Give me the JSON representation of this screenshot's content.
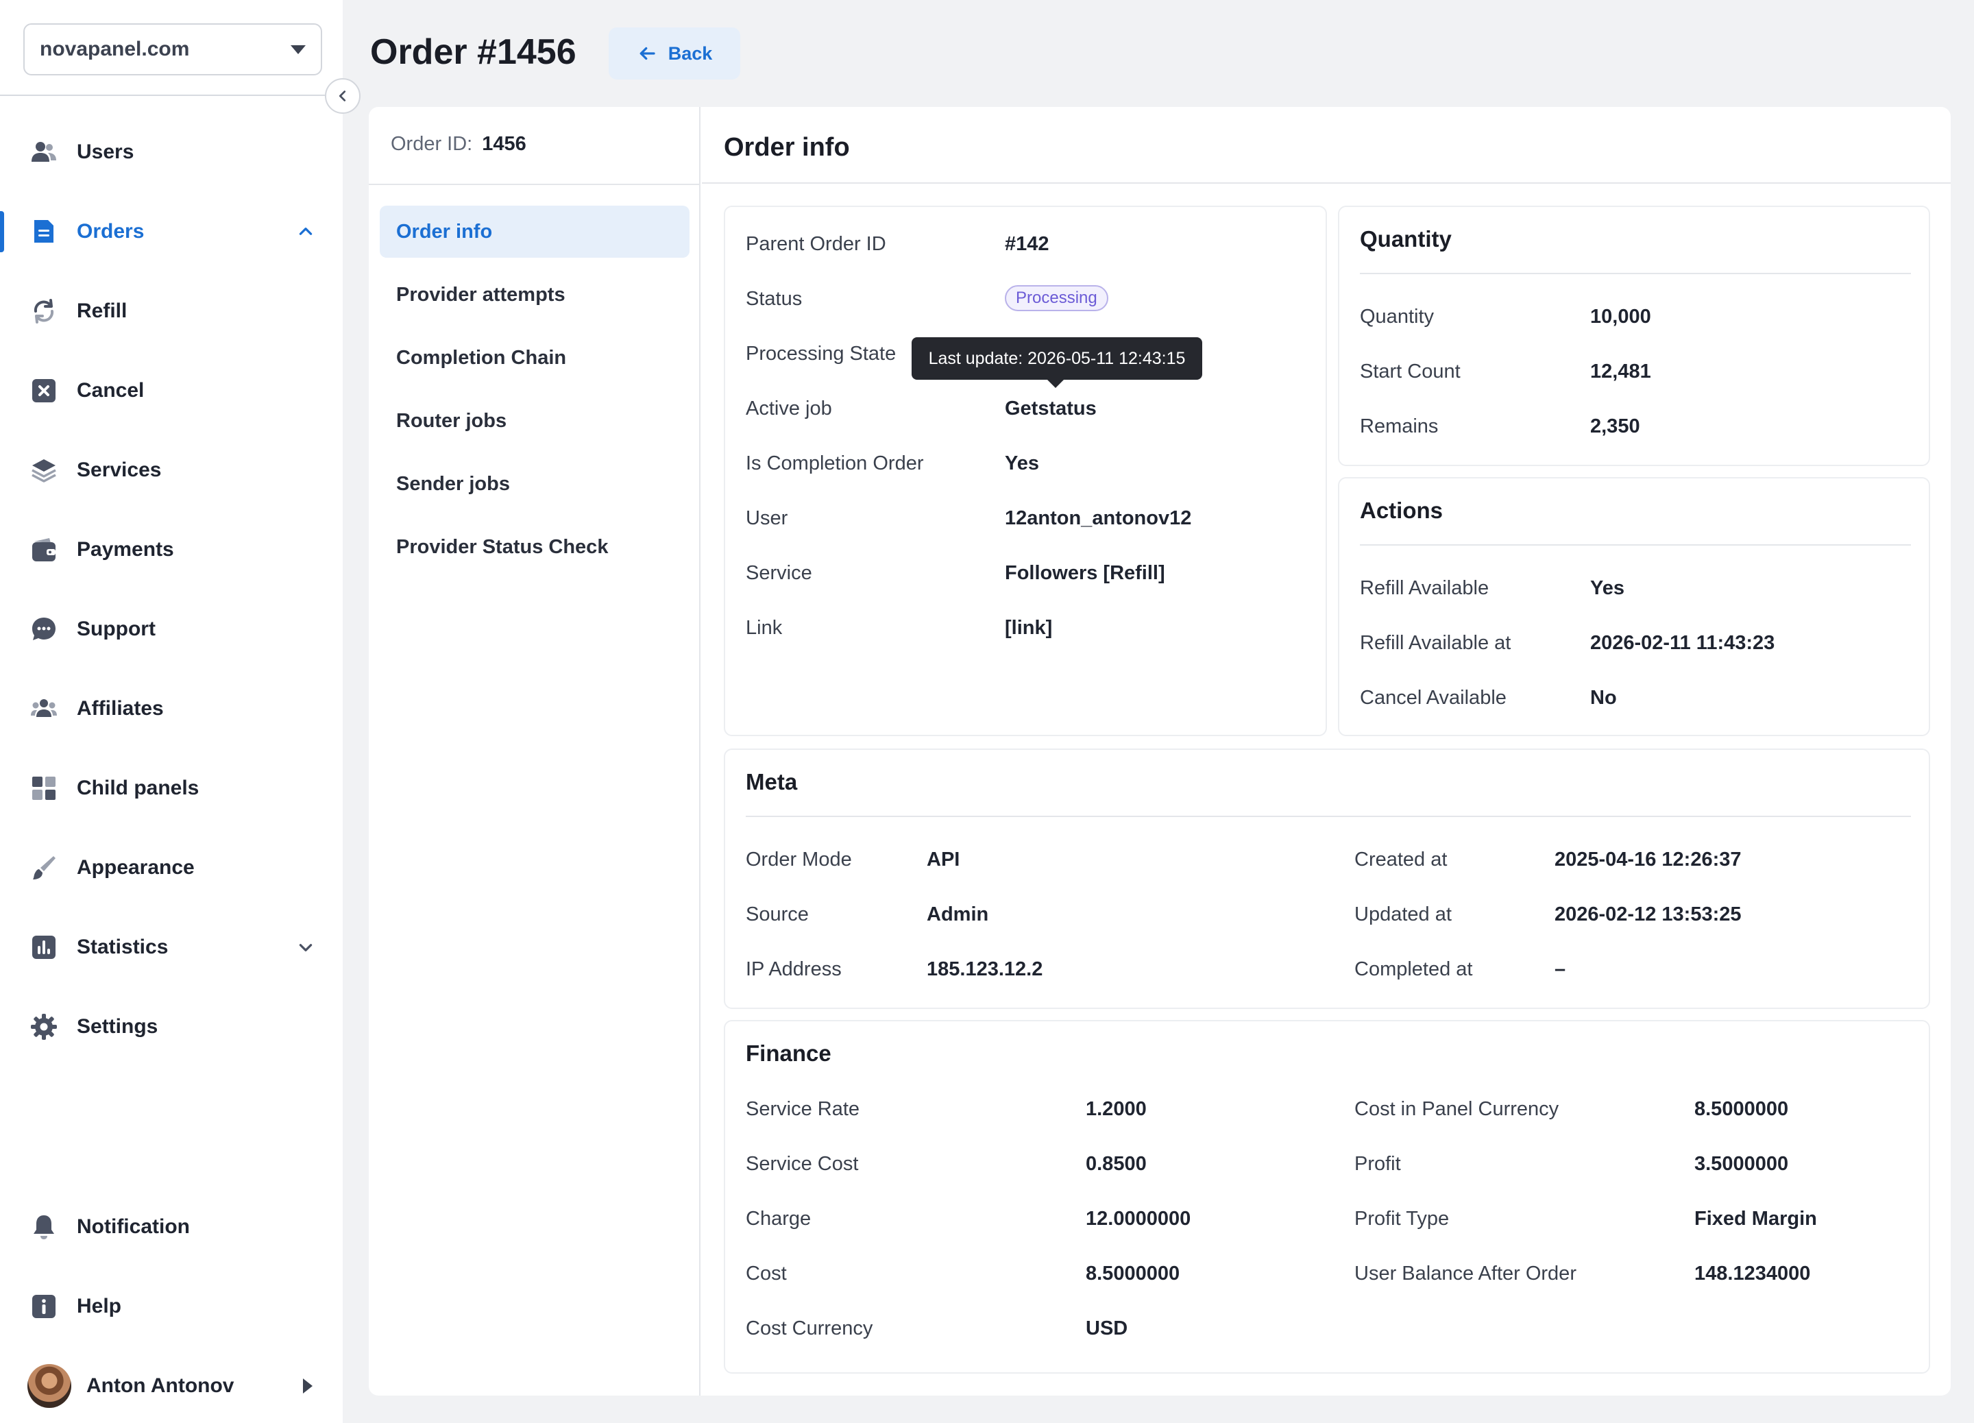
{
  "sidebar": {
    "domain": "novapanel.com",
    "items": [
      {
        "label": "Users",
        "icon": "users-icon"
      },
      {
        "label": "Orders",
        "icon": "document-icon",
        "active": true
      },
      {
        "label": "Refill",
        "icon": "refresh-icon"
      },
      {
        "label": "Cancel",
        "icon": "x-square-icon"
      },
      {
        "label": "Services",
        "icon": "layers-icon"
      },
      {
        "label": "Payments",
        "icon": "wallet-icon"
      },
      {
        "label": "Support",
        "icon": "chat-icon"
      },
      {
        "label": "Affiliates",
        "icon": "group-icon"
      },
      {
        "label": "Child panels",
        "icon": "grid-icon"
      },
      {
        "label": "Appearance",
        "icon": "brush-icon"
      },
      {
        "label": "Statistics",
        "icon": "bar-chart-icon"
      },
      {
        "label": "Settings",
        "icon": "gear-icon"
      }
    ],
    "bottom_items": [
      {
        "label": "Notification",
        "icon": "bell-icon"
      },
      {
        "label": "Help",
        "icon": "info-icon"
      }
    ],
    "user": {
      "name": "Anton Antonov"
    }
  },
  "header": {
    "title": "Order #1456",
    "back_label": "Back"
  },
  "order_summary": {
    "id_label": "Order ID:",
    "id_value": "1456"
  },
  "subnav": [
    "Order info",
    "Provider attempts",
    "Completion Chain",
    "Router jobs",
    "Sender jobs",
    "Provider Status Check"
  ],
  "main": {
    "title": "Order info",
    "details": [
      {
        "k": "Parent Order ID",
        "v": "#142"
      },
      {
        "k": "Status",
        "v": "Processing"
      },
      {
        "k": "Processing State",
        "v": ""
      },
      {
        "k": "Active job",
        "v": "Getstatus"
      },
      {
        "k": "Is Completion Order",
        "v": "Yes"
      },
      {
        "k": "User",
        "v": "12anton_antonov12"
      },
      {
        "k": "Service",
        "v": "Followers [Refill]"
      },
      {
        "k": "Link",
        "v": "[link]"
      }
    ],
    "tooltip": "Last update: 2026-05-11 12:43:15",
    "quantity": {
      "title": "Quantity",
      "rows": [
        {
          "k": "Quantity",
          "v": "10,000"
        },
        {
          "k": "Start Count",
          "v": "12,481"
        },
        {
          "k": "Remains",
          "v": "2,350"
        }
      ]
    },
    "actions": {
      "title": "Actions",
      "rows": [
        {
          "k": "Refill Available",
          "v": "Yes"
        },
        {
          "k": "Refill Available at",
          "v": "2026-02-11 11:43:23"
        },
        {
          "k": "Cancel Available",
          "v": "No"
        }
      ]
    },
    "meta": {
      "title": "Meta",
      "left": [
        {
          "k": "Order Mode",
          "v": "API"
        },
        {
          "k": "Source",
          "v": "Admin"
        },
        {
          "k": "IP Address",
          "v": "185.123.12.2"
        }
      ],
      "right": [
        {
          "k": "Created at",
          "v": "2025-04-16 12:26:37"
        },
        {
          "k": "Updated at",
          "v": "2026-02-12 13:53:25"
        },
        {
          "k": "Completed at",
          "v": "–"
        }
      ]
    },
    "finance": {
      "title": "Finance",
      "left": [
        {
          "k": "Service Rate",
          "v": "1.2000"
        },
        {
          "k": "Service Cost",
          "v": "0.8500"
        },
        {
          "k": "Charge",
          "v": "12.0000000"
        },
        {
          "k": "Cost",
          "v": "8.5000000"
        },
        {
          "k": "Cost Currency",
          "v": "USD"
        }
      ],
      "right": [
        {
          "k": "Cost in Panel Currency",
          "v": "8.5000000"
        },
        {
          "k": "Profit",
          "v": "3.5000000"
        },
        {
          "k": "Profit Type",
          "v": "Fixed Margin"
        },
        {
          "k": "User Balance After Order",
          "v": "148.1234000"
        }
      ]
    }
  },
  "colors": {
    "accent": "#1b6fd3",
    "status_badge": "#6b5bd6",
    "background": "#f1f2f4"
  }
}
